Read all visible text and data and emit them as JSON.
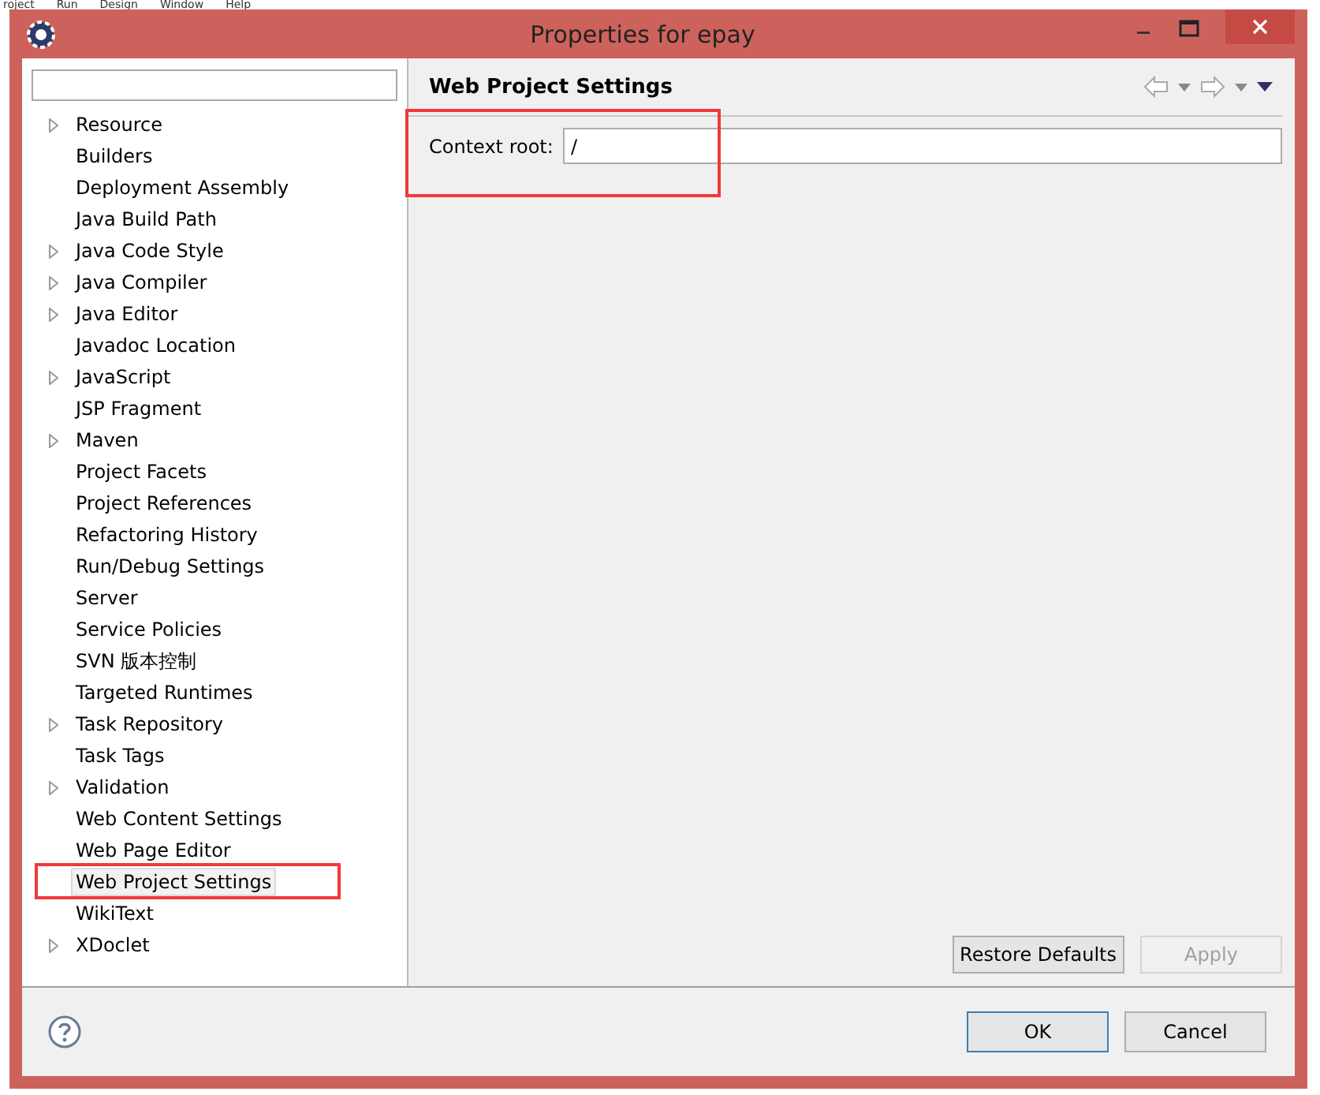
{
  "background_menu": [
    "roject",
    "Run",
    "Design",
    "Window",
    "Help"
  ],
  "window": {
    "title": "Properties for epay"
  },
  "tree": {
    "items": [
      {
        "label": "Resource",
        "expandable": true,
        "selected": false
      },
      {
        "label": "Builders",
        "expandable": false,
        "selected": false
      },
      {
        "label": "Deployment Assembly",
        "expandable": false,
        "selected": false
      },
      {
        "label": "Java Build Path",
        "expandable": false,
        "selected": false
      },
      {
        "label": "Java Code Style",
        "expandable": true,
        "selected": false
      },
      {
        "label": "Java Compiler",
        "expandable": true,
        "selected": false
      },
      {
        "label": "Java Editor",
        "expandable": true,
        "selected": false
      },
      {
        "label": "Javadoc Location",
        "expandable": false,
        "selected": false
      },
      {
        "label": "JavaScript",
        "expandable": true,
        "selected": false
      },
      {
        "label": "JSP Fragment",
        "expandable": false,
        "selected": false
      },
      {
        "label": "Maven",
        "expandable": true,
        "selected": false
      },
      {
        "label": "Project Facets",
        "expandable": false,
        "selected": false
      },
      {
        "label": "Project References",
        "expandable": false,
        "selected": false
      },
      {
        "label": "Refactoring History",
        "expandable": false,
        "selected": false
      },
      {
        "label": "Run/Debug Settings",
        "expandable": false,
        "selected": false
      },
      {
        "label": "Server",
        "expandable": false,
        "selected": false
      },
      {
        "label": "Service Policies",
        "expandable": false,
        "selected": false
      },
      {
        "label": "SVN 版本控制",
        "expandable": false,
        "selected": false
      },
      {
        "label": "Targeted Runtimes",
        "expandable": false,
        "selected": false
      },
      {
        "label": "Task Repository",
        "expandable": true,
        "selected": false
      },
      {
        "label": "Task Tags",
        "expandable": false,
        "selected": false
      },
      {
        "label": "Validation",
        "expandable": true,
        "selected": false
      },
      {
        "label": "Web Content Settings",
        "expandable": false,
        "selected": false
      },
      {
        "label": "Web Page Editor",
        "expandable": false,
        "selected": false
      },
      {
        "label": "Web Project Settings",
        "expandable": false,
        "selected": true
      },
      {
        "label": "WikiText",
        "expandable": false,
        "selected": false
      },
      {
        "label": "XDoclet",
        "expandable": true,
        "selected": false
      }
    ]
  },
  "page": {
    "title": "Web Project Settings",
    "fields": [
      {
        "label": "Context root:",
        "value": "/"
      }
    ],
    "buttons": [
      {
        "label": "Restore Defaults",
        "disabled": false
      },
      {
        "label": "Apply",
        "disabled": true
      }
    ]
  },
  "footer": {
    "buttons": [
      {
        "label": "OK",
        "default": true
      },
      {
        "label": "Cancel",
        "default": false
      }
    ]
  }
}
